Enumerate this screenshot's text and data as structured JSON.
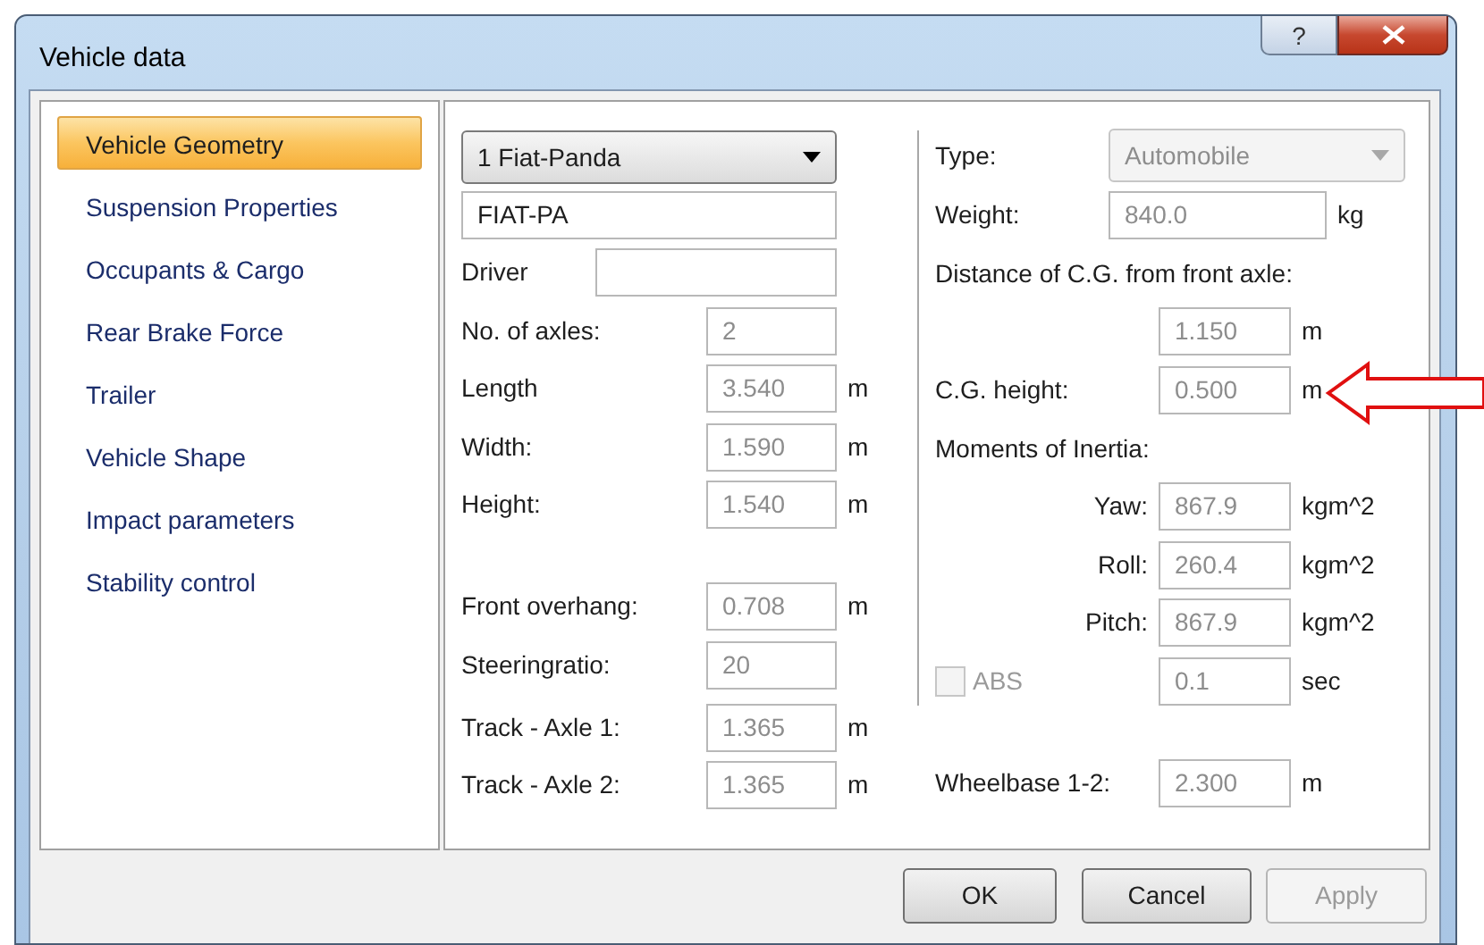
{
  "window": {
    "title": "Vehicle data",
    "help_label": "?"
  },
  "sidebar": {
    "items": [
      {
        "label": "Vehicle Geometry",
        "selected": true
      },
      {
        "label": "Suspension Properties",
        "selected": false
      },
      {
        "label": "Occupants & Cargo",
        "selected": false
      },
      {
        "label": "Rear Brake Force",
        "selected": false
      },
      {
        "label": "Trailer",
        "selected": false
      },
      {
        "label": "Vehicle Shape",
        "selected": false
      },
      {
        "label": "Impact parameters",
        "selected": false
      },
      {
        "label": "Stability control",
        "selected": false
      }
    ]
  },
  "vehicle_select": {
    "value": "1 Fiat-Panda",
    "disabled": false
  },
  "code_field": {
    "value": "FIAT-PA",
    "disabled": false
  },
  "left_groups": [
    [
      {
        "kind": "wide",
        "label": "Driver"
      },
      {
        "kind": "field",
        "label": "No. of axles:",
        "value": "2",
        "disabled": true
      },
      {
        "kind": "field",
        "label": "Length",
        "value": "3.540",
        "unit": "m",
        "disabled": true
      },
      {
        "kind": "field",
        "label": "Width:",
        "value": "1.590",
        "unit": "m",
        "disabled": true
      },
      {
        "kind": "field",
        "label": "Height:",
        "value": "1.540",
        "unit": "m",
        "disabled": true
      }
    ],
    [
      {
        "kind": "field",
        "label": "Front overhang:",
        "value": "0.708",
        "unit": "m",
        "disabled": true
      },
      {
        "kind": "field",
        "label": "Steeringratio:",
        "value": "20",
        "disabled": true
      }
    ],
    [
      {
        "kind": "field",
        "label": "Track - Axle 1:",
        "value": "1.365",
        "unit": "m",
        "disabled": true
      },
      {
        "kind": "field",
        "label": "Track - Axle 2:",
        "value": "1.365",
        "unit": "m",
        "disabled": true
      }
    ]
  ],
  "right_groups": [
    [
      {
        "kind": "combo",
        "label": "Type:",
        "value": "Automobile",
        "disabled": true
      },
      {
        "kind": "wide",
        "label": "Weight:",
        "value": "840.0",
        "unit": "kg",
        "disabled": true
      },
      {
        "kind": "heading",
        "label": "Distance of C.G. from front axle:"
      },
      {
        "kind": "field",
        "value": "1.150",
        "unit": "m",
        "disabled": true
      },
      {
        "kind": "field",
        "label": "C.G. height:",
        "value": "0.500",
        "unit": "m",
        "disabled": true
      },
      {
        "kind": "heading",
        "label": "Moments of Inertia:"
      },
      {
        "kind": "indented",
        "label": "Yaw:",
        "value": "867.9",
        "unit": "kgm^2",
        "disabled": true
      },
      {
        "kind": "indented",
        "label": "Roll:",
        "value": "260.4",
        "unit": "kgm^2",
        "disabled": true
      },
      {
        "kind": "indented",
        "label": "Pitch:",
        "value": "867.9",
        "unit": "kgm^2",
        "disabled": true
      },
      {
        "kind": "checkbox",
        "label": "ABS",
        "checked": false,
        "disabled": true,
        "value": "0.1",
        "unit": "sec"
      }
    ],
    [
      {
        "kind": "field",
        "label": "Wheelbase 1-2:",
        "value": "2.300",
        "unit": "m",
        "disabled": true
      }
    ]
  ],
  "buttons": [
    {
      "label": "OK",
      "disabled": false
    },
    {
      "label": "Cancel",
      "disabled": false
    },
    {
      "label": "Apply",
      "disabled": true
    }
  ]
}
